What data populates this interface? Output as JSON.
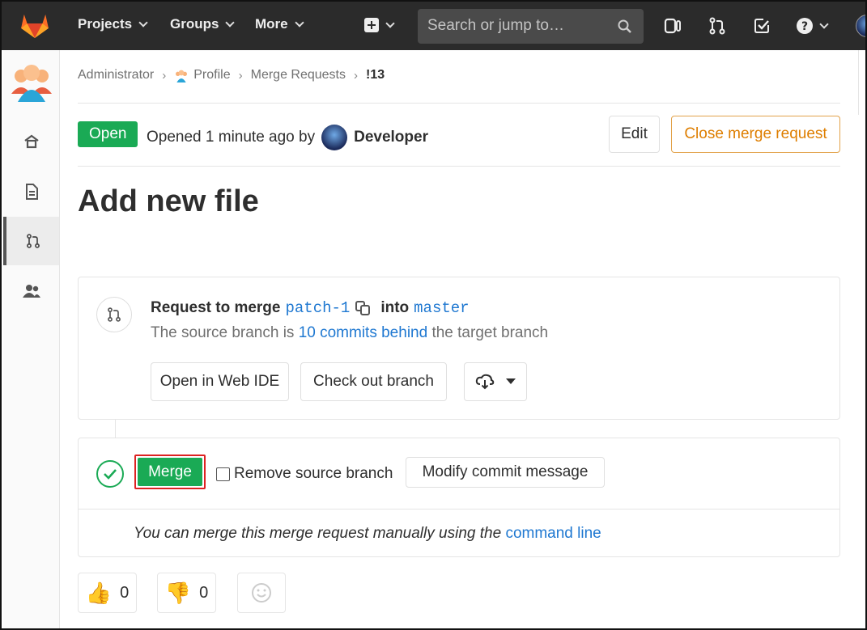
{
  "topnav": {
    "items": [
      {
        "label": "Projects"
      },
      {
        "label": "Groups"
      },
      {
        "label": "More"
      }
    ],
    "search_placeholder": "Search or jump to…",
    "icons": [
      "plus-square-icon",
      "search-icon",
      "issues-icon",
      "merge-requests-icon",
      "todos-icon",
      "help-icon",
      "user-avatar"
    ]
  },
  "sidebar": {
    "items": [
      "project-avatar",
      "home-icon",
      "overview-icon",
      "merge-requests-icon",
      "members-icon"
    ],
    "active": "merge-requests-icon"
  },
  "breadcrumb": {
    "items": [
      "Administrator",
      "Profile",
      "Merge Requests",
      "!13"
    ]
  },
  "header": {
    "status": "Open",
    "opened_text": "Opened 1 minute ago by",
    "author": "Developer",
    "edit_label": "Edit",
    "close_label": "Close merge request"
  },
  "title": "Add new file",
  "branch_info": {
    "prefix": "Request to merge",
    "source": "patch-1",
    "into": "into",
    "target": "master",
    "sub_prefix": "The source branch is",
    "behind_link": "10 commits behind",
    "sub_suffix": "the target branch",
    "web_ide_label": "Open in Web IDE",
    "checkout_label": "Check out branch"
  },
  "merge_widget": {
    "merge_label": "Merge",
    "remove_source_label": "Remove source branch",
    "modify_commit_label": "Modify commit message",
    "manual_text": "You can merge this merge request manually using the",
    "command_line_link": "command line"
  },
  "awards": {
    "thumbs_up_count": "0",
    "thumbs_down_count": "0"
  },
  "colors": {
    "nav_bg": "#2b2b2b",
    "green": "#1aaa55",
    "link_blue": "#1f78d1",
    "warning_orange": "#de7e00"
  }
}
